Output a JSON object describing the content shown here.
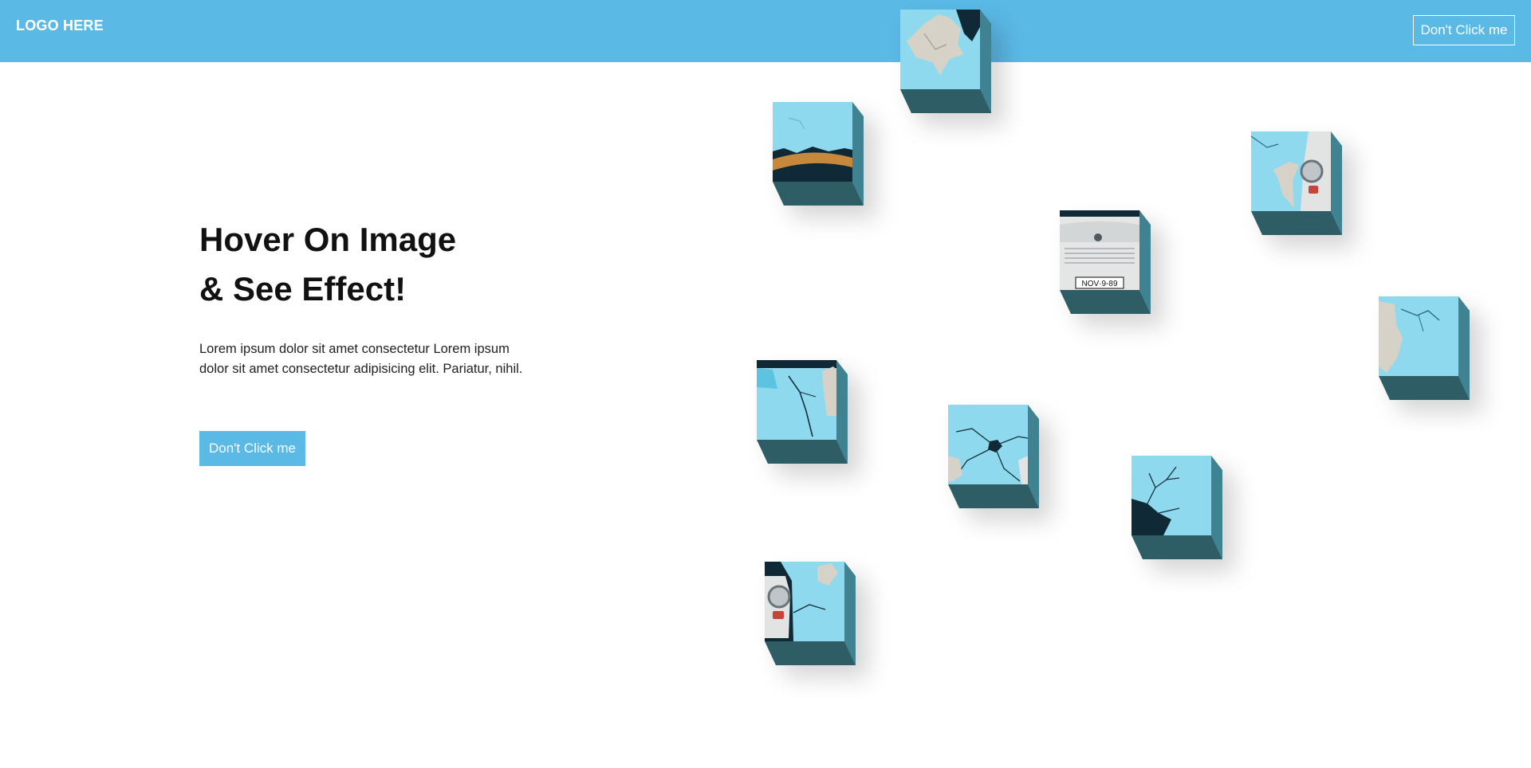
{
  "header": {
    "logo_text": "LOGO HERE",
    "cta_label": "Don't Click me"
  },
  "hero": {
    "title_line1": "Hover On Image",
    "title_line2": "& See Effect!",
    "description": "Lorem ipsum dolor sit amet consectetur Lorem ipsum dolor sit amet consectetur adipisicing elit. Pariatur, nihil.",
    "button_label": "Don't Click me"
  },
  "plate_text": "NOV·9-89",
  "colors": {
    "header_bg": "#5bb9e6",
    "cube_face": "#8fd9ef",
    "cube_right": "#3f8392",
    "cube_bottom": "#2e5d66",
    "text_dark": "#111111"
  }
}
